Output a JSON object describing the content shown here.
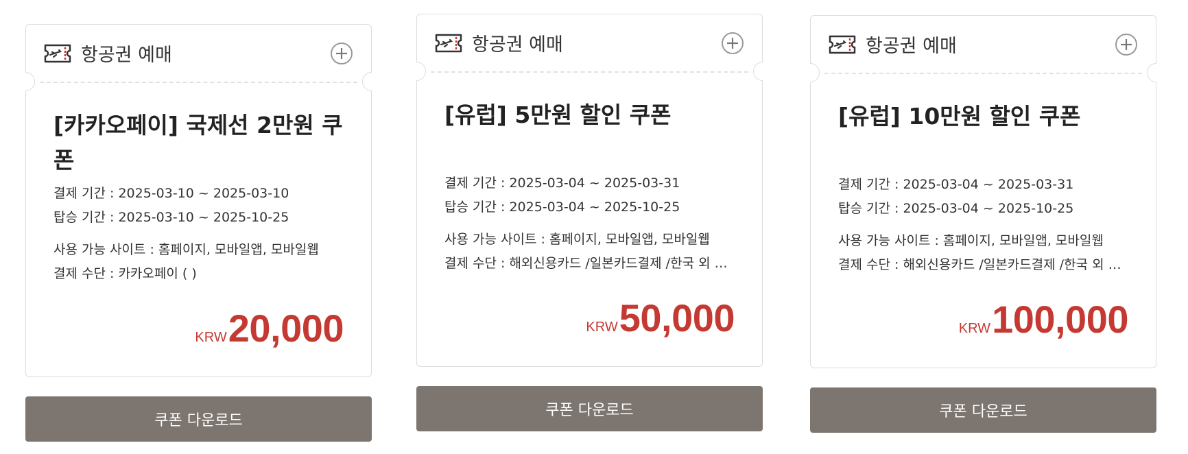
{
  "accent_color": "#c43a32",
  "button_color": "#7d7670",
  "coupons": [
    {
      "category": "항공권 예매",
      "category_icon": "airplane-ticket-icon",
      "title": "[카카오페이] 국제선 2만원 쿠폰",
      "payment_period": "결제 기간 : 2025-03-10 ~ 2025-03-10",
      "boarding_period": "탑승 기간 : 2025-03-10 ~ 2025-10-25",
      "sites": "사용 가능 사이트 : 홈페이지, 모바일앱, 모바일웹",
      "payment_method": "결제 수단 : 카카오페이 ( )",
      "currency": "KRW",
      "amount": "20,000",
      "button_label": "쿠폰 다운로드"
    },
    {
      "category": "항공권 예매",
      "category_icon": "airplane-ticket-icon",
      "title": "[유럽] 5만원 할인 쿠폰",
      "payment_period": "결제 기간 : 2025-03-04 ~ 2025-03-31",
      "boarding_period": "탑승 기간 : 2025-03-04 ~ 2025-10-25",
      "sites": "사용 가능 사이트 : 홈페이지, 모바일앱, 모바일웹",
      "payment_method": "결제 수단 : 해외신용카드 /일본카드결제 /한국 외 발급 카드",
      "currency": "KRW",
      "amount": "50,000",
      "button_label": "쿠폰 다운로드"
    },
    {
      "category": "항공권 예매",
      "category_icon": "airplane-ticket-icon",
      "title": "[유럽] 10만원 할인 쿠폰",
      "payment_period": "결제 기간 : 2025-03-04 ~ 2025-03-31",
      "boarding_period": "탑승 기간 : 2025-03-04 ~ 2025-10-25",
      "sites": "사용 가능 사이트 : 홈페이지, 모바일앱, 모바일웹",
      "payment_method": "결제 수단 : 해외신용카드 /일본카드결제 /한국 외 발급 카드",
      "currency": "KRW",
      "amount": "100,000",
      "button_label": "쿠폰 다운로드"
    }
  ]
}
